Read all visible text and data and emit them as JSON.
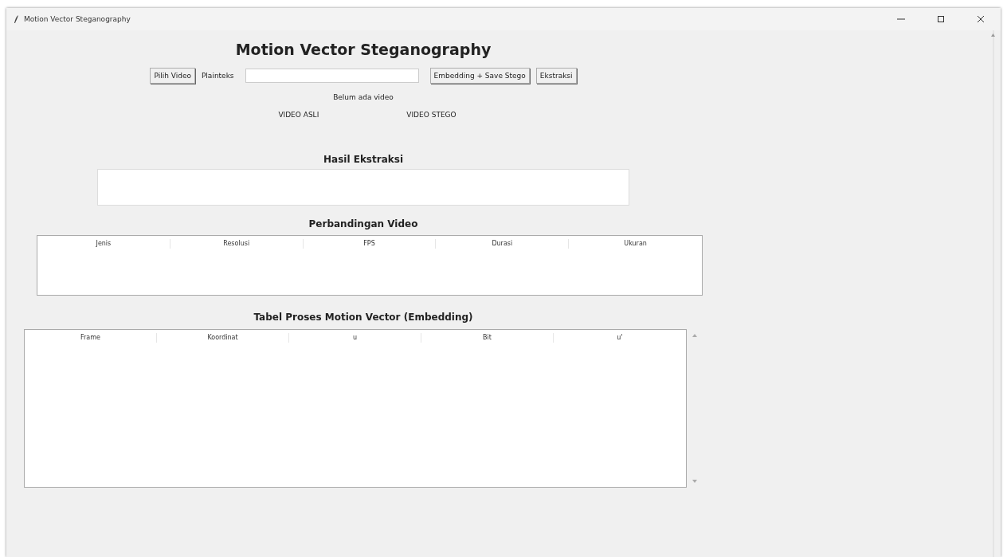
{
  "window": {
    "title": "Motion Vector Steganography"
  },
  "heading": "Motion Vector Steganography",
  "toolbar": {
    "pick_button": "Pilih Video",
    "plaintext_label": "Plainteks",
    "embed_button": "Embedding + Save Stego",
    "extract_button": "Ekstraksi"
  },
  "status": "Belum ada video",
  "video_labels": [
    "VIDEO ASLI",
    "VIDEO STEGO"
  ],
  "extraction": {
    "title": "Hasil Ekstraksi"
  },
  "comparison": {
    "title": "Perbandingan Video",
    "columns": [
      "Jenis",
      "Resolusi",
      "FPS",
      "Durasi",
      "Ukuran"
    ]
  },
  "process": {
    "title": "Tabel Proses Motion Vector (Embedding)",
    "columns": [
      "Frame",
      "Koordinat",
      "u",
      "Bit",
      "u'"
    ]
  }
}
